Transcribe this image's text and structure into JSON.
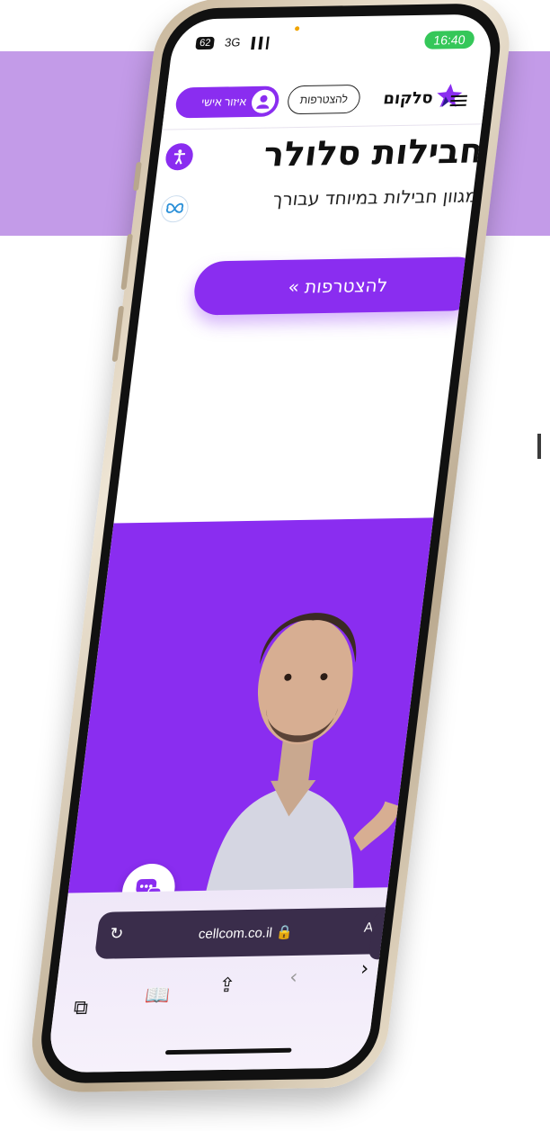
{
  "status_bar": {
    "signal_badge": "62",
    "network": "3G",
    "signal_icon": "signal-bars-icon",
    "time": "16:40",
    "time_pill_color": "#35c759"
  },
  "header": {
    "personal_area_label": "איזור אישי",
    "join_label": "להצטרפות",
    "logo_text": "סלקום",
    "menu_icon": "menu-icon"
  },
  "hero_text": {
    "title": "חבילות סלולר",
    "subtitle": "מגוון חבילות במיוחד עבורך",
    "cta_label": "להצטרפות »"
  },
  "floating_icons": {
    "accessibility": "accessibility-icon",
    "butterfly": "butterfly-icon",
    "chat": "chat-bubble-icon"
  },
  "browser": {
    "url": "cellcom.co.il 🔒",
    "aa_label": "AA",
    "reload_icon": "reload-icon",
    "back_icon": "back-icon",
    "forward_icon": "forward-icon",
    "share_icon": "share-icon",
    "bookmarks_icon": "bookmarks-icon",
    "tabs_icon": "tabs-icon"
  },
  "colors": {
    "brand_purple": "#8a2df0",
    "background_band": "#c39be8",
    "url_bar": "#3a2d4b"
  }
}
